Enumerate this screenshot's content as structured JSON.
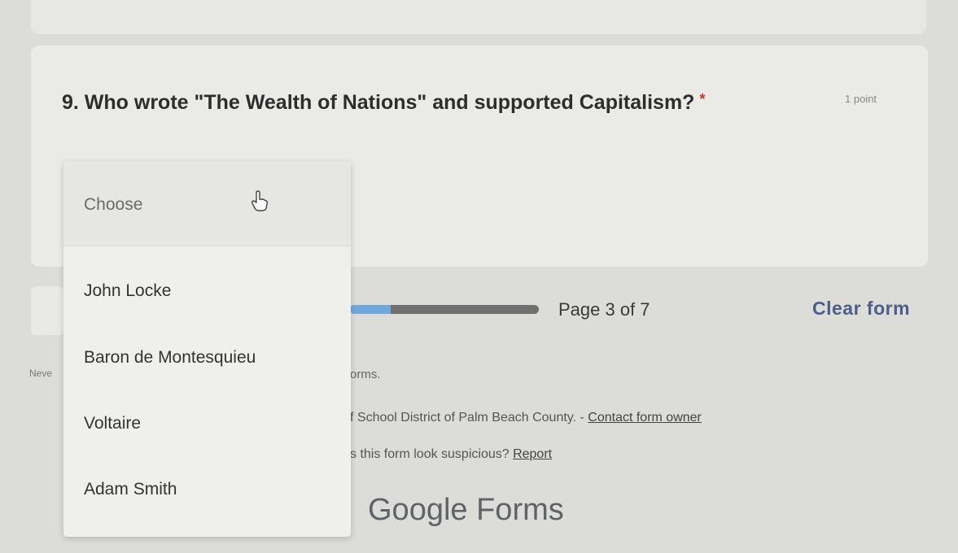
{
  "question": {
    "title": "9. Who wrote \"The Wealth of Nations\" and supported Capitalism?",
    "required_mark": "*",
    "points": "1 point"
  },
  "dropdown": {
    "placeholder": "Choose",
    "options": [
      "John Locke",
      "Baron de Montesquieu",
      "Voltaire",
      "Adam Smith"
    ]
  },
  "navigation": {
    "page_indicator": "Page 3 of 7",
    "progress_fraction": 0.214,
    "clear_form": "Clear form"
  },
  "footer": {
    "never_text": "Neve",
    "forms_text": "orms.",
    "owner_text": "f School District of Palm Beach County. - ",
    "contact_link": "Contact form owner",
    "suspicious_text": "s this form look suspicious? ",
    "report_link": "Report",
    "brand": "Google Forms"
  },
  "icons": {
    "cursor": "hand-pointer-icon"
  },
  "colors": {
    "required": "#d93025",
    "progress_fill": "#6fa8dc",
    "clear_form": "#4a5e8a"
  }
}
